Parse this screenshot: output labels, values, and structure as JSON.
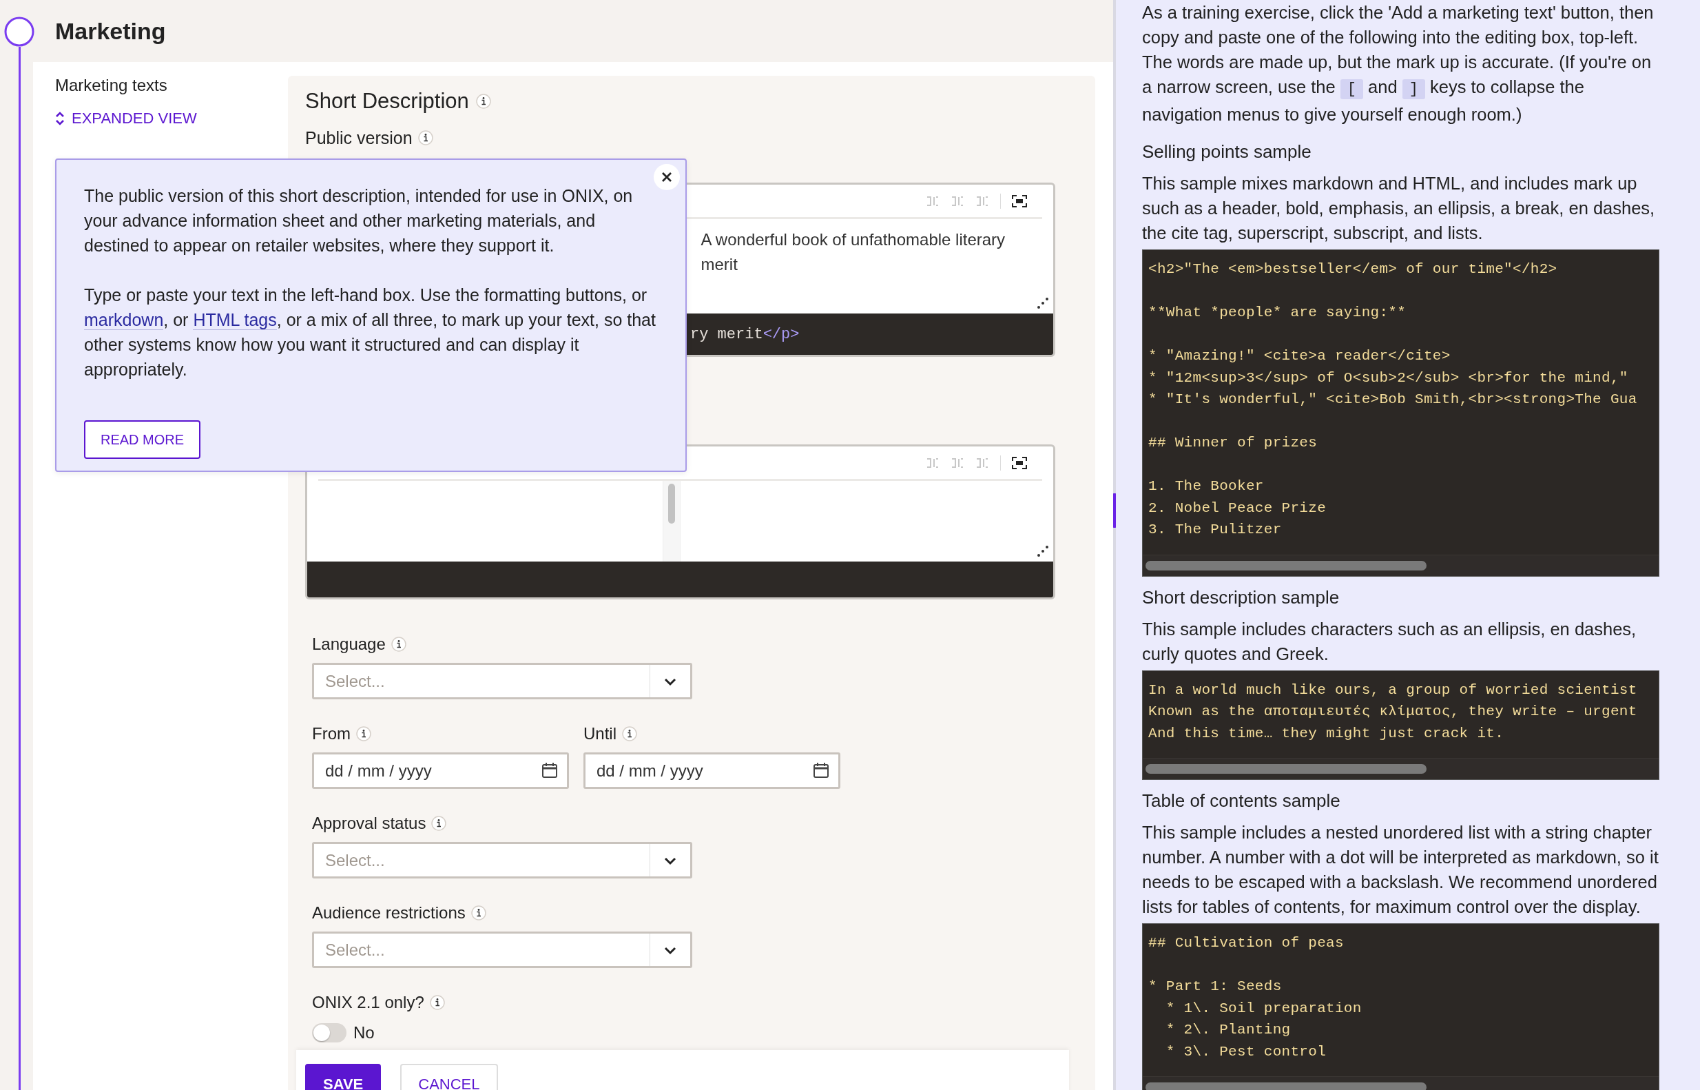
{
  "section": {
    "title": "Marketing"
  },
  "sidebar": {
    "title": "Marketing texts",
    "view_toggle": "EXPANDED VIEW"
  },
  "card": {
    "title": "Short Description",
    "subtitle": "Public version",
    "editors": [
      {
        "kind": "filled",
        "preview": "A wonderful book of unfathomable literary merit",
        "code": [
          {
            "kind": "text",
            "text": "ry merit"
          },
          {
            "kind": "tag",
            "text": "</p>"
          }
        ]
      },
      {
        "kind": "empty"
      }
    ],
    "form": [
      {
        "kind": "select",
        "label": "Language",
        "placeholder": "Select..."
      },
      {
        "kind": "dates",
        "fields": [
          {
            "label": "From",
            "placeholder": "dd / mm / yyyy"
          },
          {
            "label": "Until",
            "placeholder": "dd / mm / yyyy"
          }
        ]
      },
      {
        "kind": "select",
        "label": "Approval status",
        "placeholder": "Select..."
      },
      {
        "kind": "select",
        "label": "Audience restrictions",
        "placeholder": "Select..."
      },
      {
        "kind": "toggle",
        "label": "ONIX 2.1 only?",
        "on": false,
        "value": "No"
      }
    ],
    "buttons": [
      {
        "kind": "primary",
        "label": "SAVE"
      },
      {
        "kind": "secondary",
        "label": "CANCEL"
      }
    ]
  },
  "popover": {
    "paragraphs": [
      [
        {
          "kind": "text",
          "text": "The public version of this short description, intended for use in ONIX, on your advance information sheet and other marketing materials, and destined to appear on retailer websites, where they support it."
        }
      ],
      [
        {
          "kind": "text",
          "text": "Type or paste your text in the left-hand box. Use the formatting buttons, or "
        },
        {
          "kind": "link",
          "text": "markdown"
        },
        {
          "kind": "text",
          "text": ", or "
        },
        {
          "kind": "link",
          "text": "HTML tags"
        },
        {
          "kind": "text",
          "text": ", or a mix of all three, to mark up your text, so that other systems know how you want it structured and can display it appropriately."
        }
      ]
    ],
    "button": "READ MORE"
  },
  "help": {
    "intro": [
      {
        "kind": "text",
        "text": "As a training exercise, click the 'Add a marketing text' button, then copy and paste one of the following into the editing box, top-left. The words are made up, but the mark up is accurate. (If you're on a narrow screen, use the "
      },
      {
        "kind": "key",
        "text": "["
      },
      {
        "kind": "text",
        "text": " and "
      },
      {
        "kind": "key",
        "text": "]"
      },
      {
        "kind": "text",
        "text": " keys to collapse the navigation menus to give yourself enough room.)"
      }
    ],
    "samples": [
      {
        "title": "Selling points sample",
        "description": "This sample mixes markdown and HTML, and includes mark up such as a header, bold, emphasis, an ellipsis, a break, en dashes, the cite tag, superscript, subscript, and lists.",
        "code": "<h2>\"The <em>bestseller</em> of our time\"</h2>\n\n**What *people* are saying:**\n\n* \"Amazing!\" <cite>a reader</cite>\n* \"12m<sup>3</sup> of O<sub>2</sub> <br>for the mind,\"\n* \"It's wonderful,\" <cite>Bob Smith,<br><strong>The Gua\n\n## Winner of prizes\n\n1. The Booker\n2. Nobel Peace Prize\n3. The Pulitzer"
      },
      {
        "title": "Short description sample",
        "description": "This sample includes characters such as an ellipsis, en dashes, curly quotes and Greek.",
        "code": "In a world much like ours, a group of worried scientist\nKnown as the αποταμιευτές κλίματος, they write – urgent\nAnd this time… they might just crack it."
      },
      {
        "title": "Table of contents sample",
        "description": "This sample includes a nested unordered list with a string chapter number. A number with a dot will be interpreted as markdown, so it needs to be escaped with a backslash. We recommend unordered lists for tables of contents, for maximum control over the display.",
        "code": "## Cultivation of peas\n\n* Part 1: Seeds\n  * 1\\. Soil preparation\n  * 2\\. Planting\n  * 3\\. Pest control"
      }
    ]
  }
}
